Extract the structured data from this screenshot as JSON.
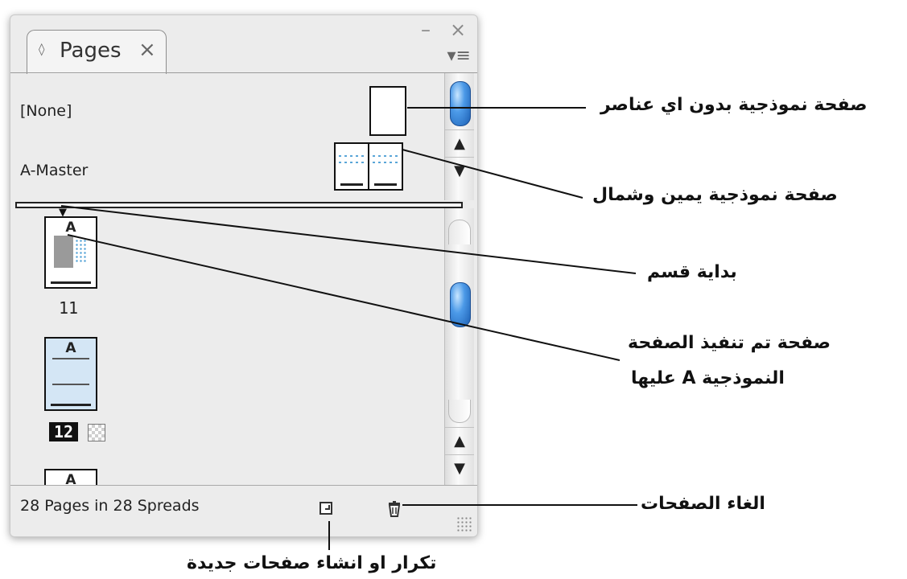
{
  "panel": {
    "minimize_glyph": "–",
    "close_glyph": "×",
    "tab": {
      "diamond_glyph": "◊",
      "label": "Pages",
      "close_glyph": "×"
    },
    "menu_glyph": "▾≡"
  },
  "masters": [
    {
      "label": "[None]"
    },
    {
      "label": "A-Master"
    }
  ],
  "pages": [
    {
      "number": "11",
      "master_letter": "A"
    },
    {
      "number": "12",
      "master_letter": "A"
    },
    {
      "number": "",
      "master_letter": "A"
    }
  ],
  "scroll_arrows": {
    "up": "▲",
    "down": "▼"
  },
  "status": {
    "text": "28 Pages in 28 Spreads",
    "new_page_icon": "new-page-icon",
    "delete_icon": "trash-icon"
  },
  "callouts": {
    "none_master": "صفحة نموذجية بدون اي عناصر",
    "spread_master": "صفحة نموذجية يمين وشمال",
    "section_start": "بداية قسم",
    "applied_master_line1": "صفحة تم تنفيذ الصفحة",
    "applied_master_line2": "النموذجية A عليها",
    "delete_pages": "الغاء الصفحات",
    "new_pages": "تكرار او انشاء صفحات جديدة"
  }
}
